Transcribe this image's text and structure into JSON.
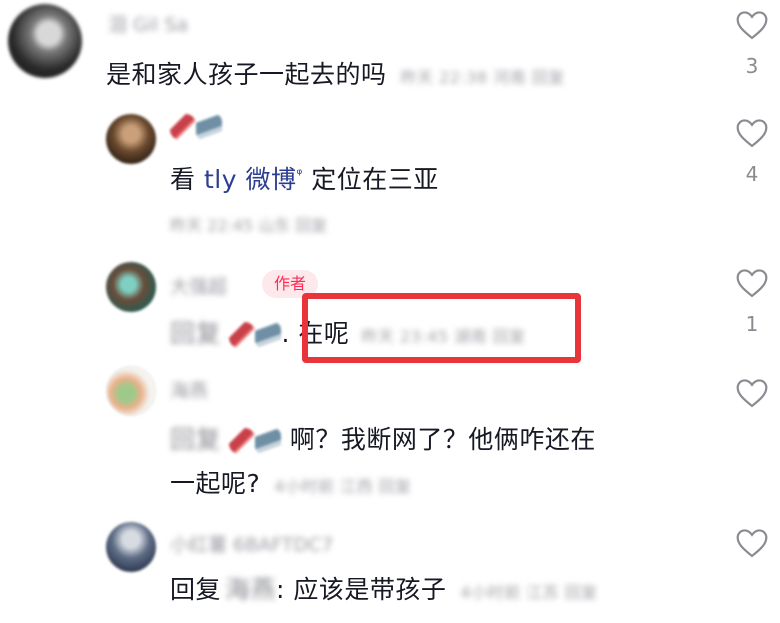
{
  "comments": [
    {
      "username": "泪 Gil Sa",
      "text": "是和家人孩子一起去的吗",
      "meta": "昨天 22:38 河南 回复",
      "likes": "3"
    },
    {
      "username": "",
      "text_prefix": "看 ",
      "link_text": "tly 微博",
      "pin": "ᵠ",
      "text_suffix": " 定位在三亚",
      "meta": "昨天 22:45 山东 回复",
      "likes": "4"
    },
    {
      "username": "大强超",
      "badge": "作者",
      "reply_prefix": "回复",
      "text": ". 在呢",
      "meta": "昨天 23:45 湖南 回复",
      "likes": "1"
    },
    {
      "username": "海燕",
      "reply_prefix": "回复",
      "text_line1": "啊？我断网了？他俩咋还在",
      "text_line2": "一起呢?",
      "meta": "4小时前 江西 回复",
      "likes": ""
    },
    {
      "username": "小红薯 6BAFTDC7",
      "reply_prefix": "回复",
      "reply_target": "海燕",
      "text": ": 应该是带孩子",
      "meta": "4小时前 江苏 回复",
      "likes": ""
    }
  ],
  "icons": {
    "like": "heart-outline-icon",
    "emoji1": "guitar-emoji",
    "emoji2": "shark-emoji"
  },
  "colors": {
    "highlight": "#e8343b",
    "author_badge": "#fe2c55",
    "link": "#2c3e91"
  }
}
